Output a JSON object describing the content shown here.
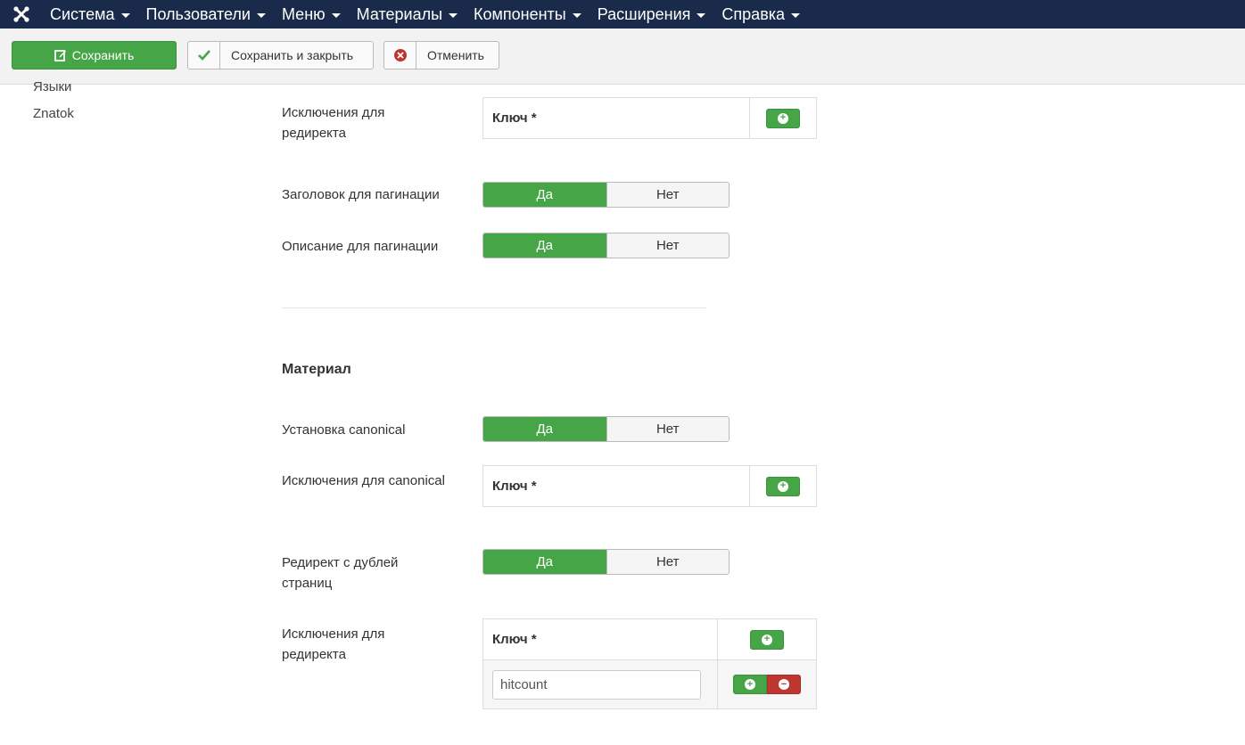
{
  "nav": {
    "items": [
      {
        "label": "Система"
      },
      {
        "label": "Пользователи"
      },
      {
        "label": "Меню"
      },
      {
        "label": "Материалы"
      },
      {
        "label": "Компоненты"
      },
      {
        "label": "Расширения"
      },
      {
        "label": "Справка"
      }
    ]
  },
  "toolbar": {
    "save_label": "Сохранить",
    "save_close_label": "Сохранить и закрыть",
    "cancel_label": "Отменить"
  },
  "sidebar": {
    "items": [
      {
        "label": "Языки"
      },
      {
        "label": "Znatok"
      }
    ]
  },
  "form": {
    "redirect_exceptions_label": "Исключения для редиректа",
    "key_header": "Ключ *",
    "pagination_title_label": "Заголовок для пагинации",
    "pagination_desc_label": "Описание для пагинации",
    "yes": "Да",
    "no": "Нет",
    "section_material": "Материал",
    "canonical_label": "Установка canonical",
    "canonical_exceptions_label": "Исключения для canonical",
    "dup_redirect_label": "Редирект с дублей страниц",
    "redirect_exceptions2_label": "Исключения для редиректа",
    "key_value": "hitcount"
  },
  "colors": {
    "navbar": "#1a2a4b",
    "success": "#46a546",
    "danger": "#bd362f"
  }
}
